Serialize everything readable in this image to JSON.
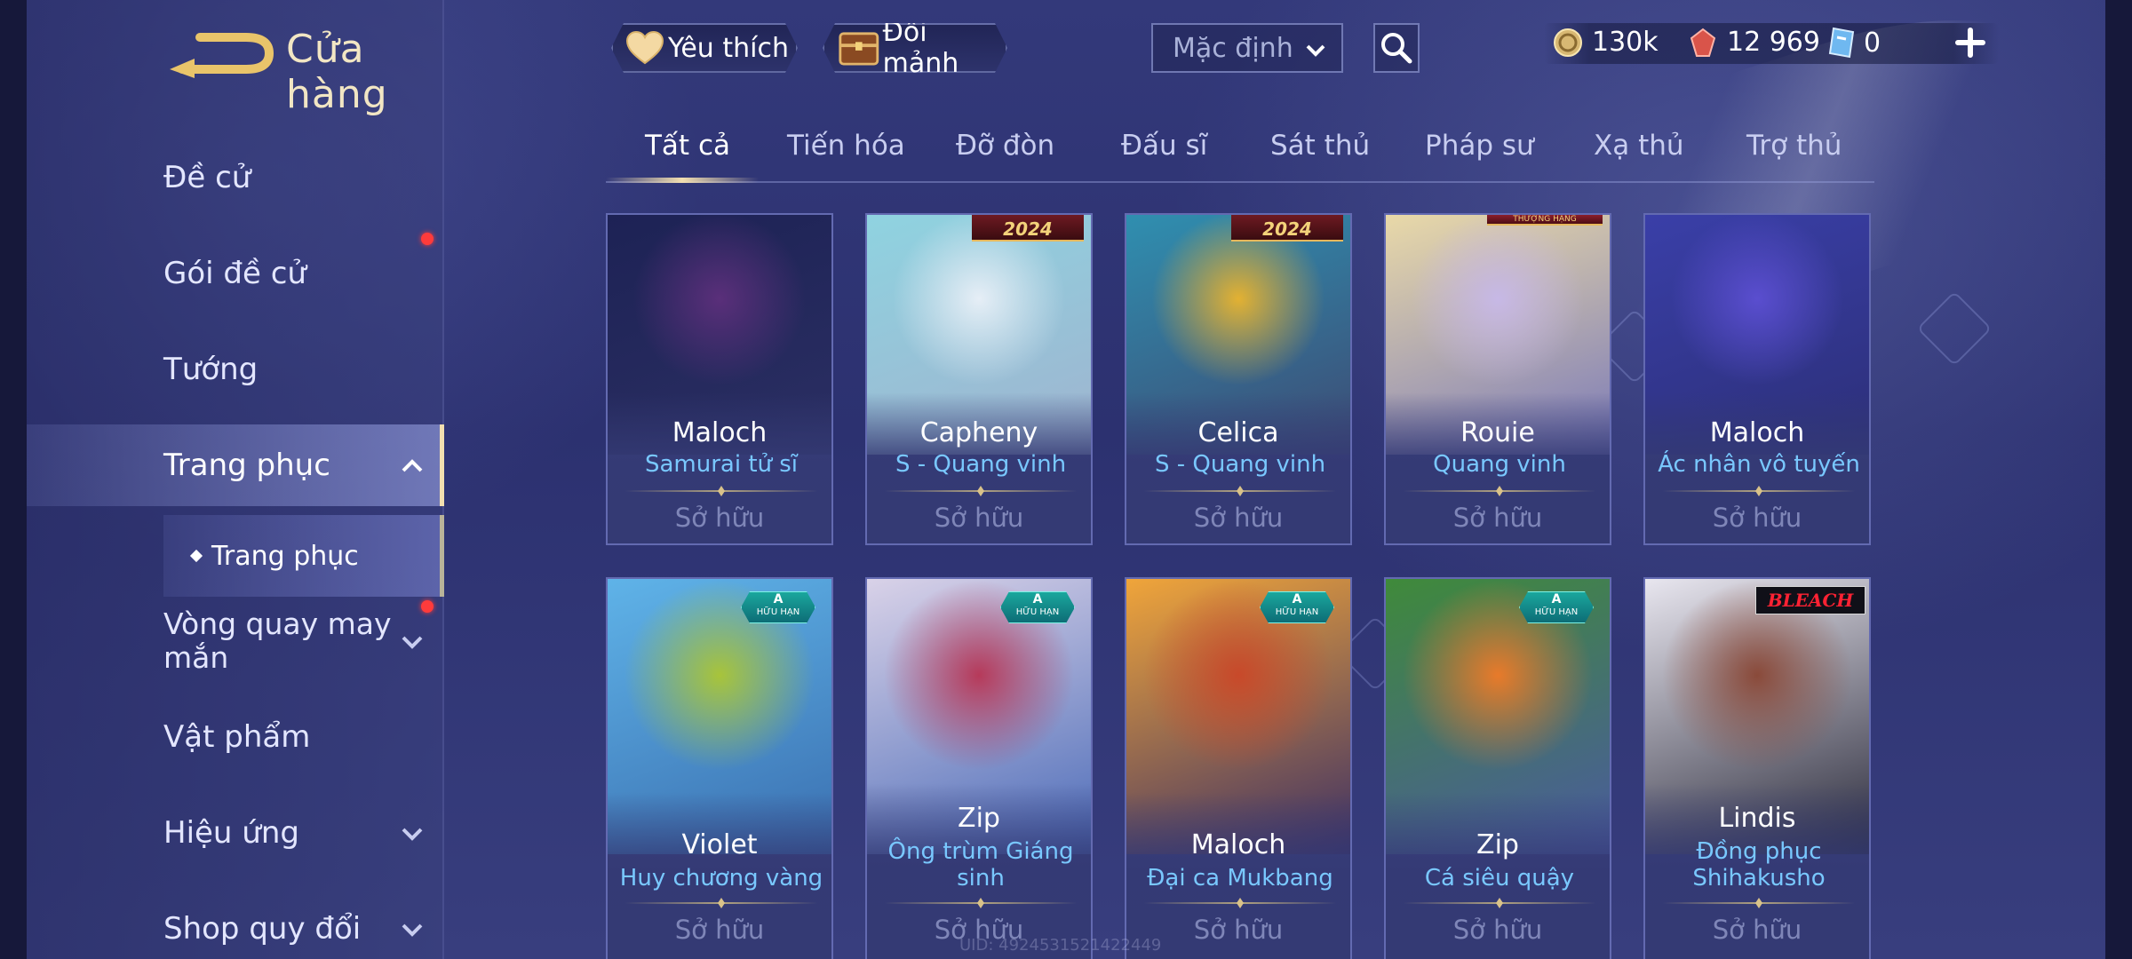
{
  "header": {
    "title": "Cửa hàng",
    "favorites_label": "Yêu thích",
    "exchange_label": "Đổi mảnh",
    "sort_value": "Mặc định"
  },
  "currencies": {
    "gold": "130k",
    "vouchers": "12 969",
    "tickets": "0"
  },
  "sidebar": {
    "items": [
      {
        "label": "Đề cử",
        "has_dot": false
      },
      {
        "label": "Gói đề cử",
        "has_dot": true
      },
      {
        "label": "Tướng",
        "has_dot": false
      },
      {
        "label": "Trang phục",
        "expanded": true
      },
      {
        "label": "Vòng quay may mắn",
        "has_dot": true
      },
      {
        "label": "Vật phẩm"
      },
      {
        "label": "Hiệu ứng"
      },
      {
        "label": "Shop quy đổi"
      }
    ],
    "sub_item": "Trang phục"
  },
  "tabs": [
    "Tất cả",
    "Tiến hóa",
    "Đỡ đòn",
    "Đấu sĩ",
    "Sát thủ",
    "Pháp sư",
    "Xạ thủ",
    "Trợ thủ"
  ],
  "active_tab": 0,
  "badges": {
    "year": "2024",
    "ribbon": "THƯỢNG HẠNG",
    "rank": "A",
    "limited": "HỮU HẠN",
    "bleach": "BLEACH"
  },
  "cards": [
    {
      "hero": "Maloch",
      "skin": "Samurai tử sĩ",
      "status": "Sở hữu",
      "colors": [
        "#1d2255",
        "#5a2f7a",
        "#2b2f63"
      ]
    },
    {
      "hero": "Capheny",
      "skin": "S - Quang vinh",
      "status": "Sở hữu",
      "colors": [
        "#8fd3e0",
        "#e6eef6",
        "#9fb3cf"
      ]
    },
    {
      "hero": "Celica",
      "skin": "S - Quang vinh",
      "status": "Sở hữu",
      "colors": [
        "#2f8fb0",
        "#e3b132",
        "#3d4a73"
      ]
    },
    {
      "hero": "Rouie",
      "skin": "Quang vinh",
      "status": "Sở hữu",
      "colors": [
        "#e9d9a8",
        "#c7b8e6",
        "#7a79b8"
      ]
    },
    {
      "hero": "Maloch",
      "skin": "Ác nhân vô tuyến",
      "status": "Sở hữu",
      "colors": [
        "#3a3fa8",
        "#5a4ecf",
        "#2c2f78"
      ]
    },
    {
      "hero": "Violet",
      "skin": "Huy chương vàng",
      "status": "Sở hữu",
      "colors": [
        "#5fb3e8",
        "#a8c43a",
        "#3a6fb0"
      ]
    },
    {
      "hero": "Zip",
      "skin": "Ông trùm Giáng sinh",
      "status": "Sở hữu",
      "colors": [
        "#d9d2e8",
        "#b63a5a",
        "#4b6bb8"
      ]
    },
    {
      "hero": "Maloch",
      "skin": "Đại ca Mukbang",
      "status": "Sở hữu",
      "colors": [
        "#f0a53a",
        "#c8492a",
        "#3c2f64"
      ]
    },
    {
      "hero": "Zip",
      "skin": "Cá siêu quậy",
      "status": "Sở hữu",
      "colors": [
        "#3f8a3a",
        "#e87a2a",
        "#4a5aa0"
      ]
    },
    {
      "hero": "Lindis",
      "skin": "Đồng phục Shihakusho",
      "status": "Sở hữu",
      "colors": [
        "#e8e6ef",
        "#8a4a3a",
        "#2a2a3a"
      ]
    }
  ],
  "uid_text": "UID: 4924531521422449"
}
